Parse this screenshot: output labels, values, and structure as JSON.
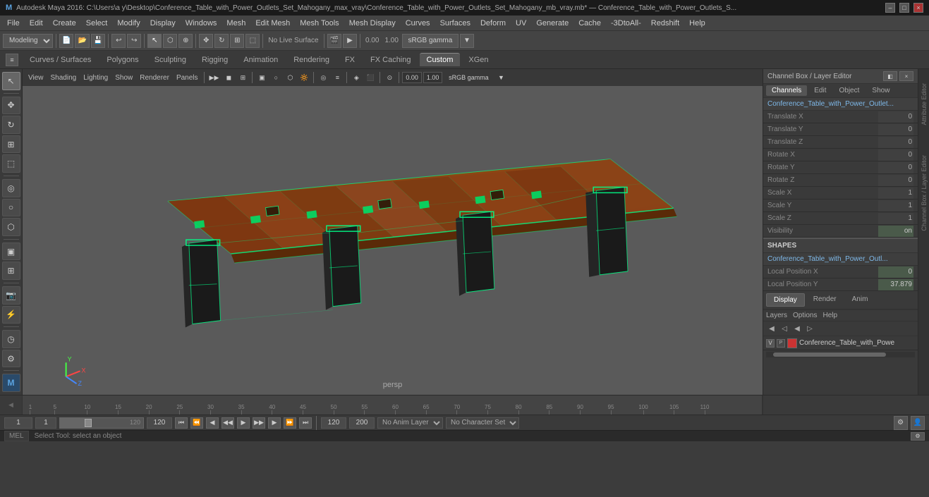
{
  "titlebar": {
    "text": "Autodesk Maya 2016: C:\\Users\\a y\\Desktop\\Conference_Table_with_Power_Outlets_Set_Mahogany_max_vray\\Conference_Table_with_Power_Outlets_Set_Mahogany_mb_vray.mb* — Conference_Table_with_Power_Outlets_S...",
    "minimize": "–",
    "maximize": "□",
    "close": "×"
  },
  "menubar": {
    "items": [
      "File",
      "Edit",
      "Create",
      "Select",
      "Modify",
      "Display",
      "Windows",
      "Mesh",
      "Edit Mesh",
      "Mesh Tools",
      "Mesh Display",
      "Curves",
      "Surfaces",
      "Deform",
      "UV",
      "Generate",
      "Cache",
      "-3DtoAll-",
      "Redshift",
      "Help"
    ]
  },
  "toolbar1": {
    "workspace": "Modeling",
    "no_live_surface": "No Live Surface",
    "gamma_label": "sRGB gamma",
    "val1": "0.00",
    "val2": "1.00"
  },
  "tabs": {
    "items": [
      "Curves / Surfaces",
      "Polygons",
      "Sculpting",
      "Rigging",
      "Animation",
      "Rendering",
      "FX",
      "FX Caching",
      "Custom",
      "XGen"
    ],
    "active": "Custom"
  },
  "viewport": {
    "menus": [
      "View",
      "Shading",
      "Lighting",
      "Show",
      "Renderer",
      "Panels"
    ],
    "persp_label": "persp",
    "toolbar_btns": [
      "▶▶",
      "◀▶",
      "◼",
      "📷",
      "🔲",
      "∿",
      "○",
      "⬡",
      "🔦",
      "◎",
      "≡",
      "🔆",
      "⊞",
      "⋯",
      "◈",
      "⬛",
      "≈",
      "⊙",
      "◷",
      "∮",
      "⊕",
      "⊖",
      "⊞",
      "⊟"
    ],
    "gamma_display": "sRGB gamma",
    "val_0": "0.00",
    "val_1": "1.00"
  },
  "channelbox": {
    "title": "Channel Box / Layer Editor",
    "tabs": {
      "channels": "Channels",
      "edit": "Edit",
      "object": "Object",
      "show": "Show"
    },
    "object_name": "Conference_Table_with_Power_Outlet...",
    "channels": [
      {
        "name": "Translate X",
        "value": "0"
      },
      {
        "name": "Translate Y",
        "value": "0"
      },
      {
        "name": "Translate Z",
        "value": "0"
      },
      {
        "name": "Rotate X",
        "value": "0"
      },
      {
        "name": "Rotate Y",
        "value": "0"
      },
      {
        "name": "Rotate Z",
        "value": "0"
      },
      {
        "name": "Scale X",
        "value": "1"
      },
      {
        "name": "Scale Y",
        "value": "1"
      },
      {
        "name": "Scale Z",
        "value": "1"
      },
      {
        "name": "Visibility",
        "value": "on"
      }
    ],
    "shapes_header": "SHAPES",
    "shapes_obj": "Conference_Table_with_Power_Outl...",
    "local_pos_x": {
      "name": "Local Position X",
      "value": "0"
    },
    "local_pos_y": {
      "name": "Local Position Y",
      "value": "37.879"
    },
    "display_tabs": [
      "Display",
      "Render",
      "Anim"
    ],
    "active_display_tab": "Display",
    "layer_menus": [
      "Layers",
      "Options",
      "Help"
    ],
    "layer_row": {
      "name": "Conference_Table_with_Powe",
      "color": "#cc3333"
    }
  },
  "bottom": {
    "frame_start": "1",
    "frame_current": "1",
    "frame_slider_val": "1",
    "frame_end_range": "120",
    "frame_end": "120",
    "frame_max": "200",
    "no_anim_layer": "No Anim Layer",
    "no_char_set": "No Character Set"
  },
  "statusbar": {
    "lang": "MEL",
    "text": "Select Tool: select an object"
  },
  "icons": {
    "arrow": "▶",
    "move": "✥",
    "rotate": "↻",
    "scale": "⊞",
    "settings": "⚙",
    "lasso": "⬡",
    "soft": "◎",
    "snap": "⊕",
    "history": "◷"
  }
}
